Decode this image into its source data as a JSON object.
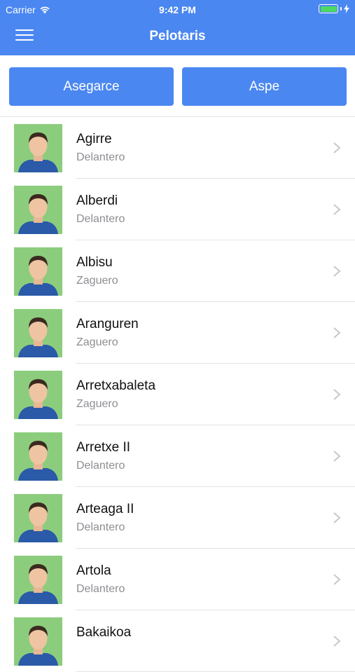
{
  "status_bar": {
    "carrier": "Carrier",
    "time": "9:42 PM"
  },
  "nav": {
    "title": "Pelotaris",
    "menu_icon": "hamburger-menu-icon"
  },
  "segments": [
    {
      "label": "Asegarce"
    },
    {
      "label": "Aspe"
    }
  ],
  "players": [
    {
      "name": "Agirre",
      "position": "Delantero"
    },
    {
      "name": "Alberdi",
      "position": "Delantero"
    },
    {
      "name": "Albisu",
      "position": "Zaguero"
    },
    {
      "name": "Aranguren",
      "position": "Zaguero"
    },
    {
      "name": "Arretxabaleta",
      "position": "Zaguero"
    },
    {
      "name": "Arretxe II",
      "position": "Delantero"
    },
    {
      "name": "Arteaga II",
      "position": "Delantero"
    },
    {
      "name": "Artola",
      "position": "Delantero"
    },
    {
      "name": "Bakaikoa",
      "position": ""
    }
  ],
  "colors": {
    "accent": "#4a87f1",
    "avatar_bg": "#8ccd7d",
    "battery": "#4cd964"
  }
}
